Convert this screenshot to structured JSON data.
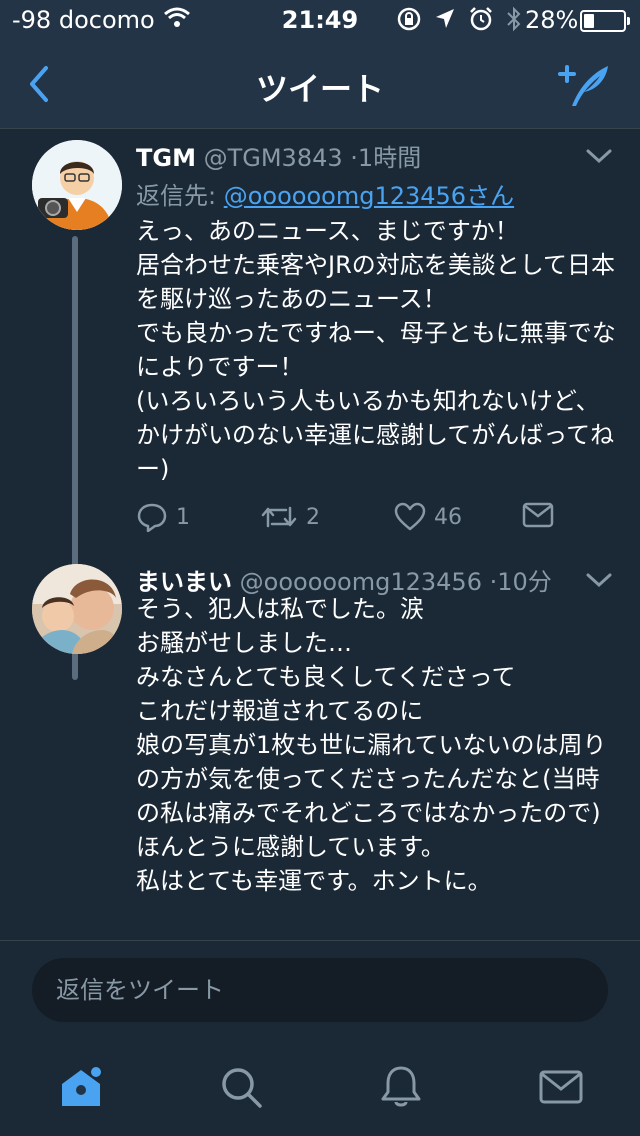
{
  "status": {
    "carrier": "-98 docomo",
    "time": "21:49",
    "battery": "28%"
  },
  "nav": {
    "title": "ツイート"
  },
  "tweets": [
    {
      "name": "TGM",
      "handle": "@TGM3843",
      "time": "1時間",
      "reply_label": "返信先:",
      "reply_to": "@oooooomg123456さん",
      "body": "えっ、あのニュース、まじですか！\n居合わせた乗客やJRの対応を美談として日本を駆け巡ったあのニュース！\nでも良かったですねー、母子ともに無事でなによりですー！\n(いろいろいう人もいるかも知れないけど、かけがいのない幸運に感謝してがんばってねー)",
      "reply_count": "1",
      "retweet_count": "2",
      "like_count": "46"
    },
    {
      "name": "まいまい",
      "handle": "@oooooomg123456",
      "time": "10分",
      "body": "そう、犯人は私でした。涙\nお騒がせしました…\nみなさんとても良くしてくださって\nこれだけ報道されてるのに\n娘の写真が1枚も世に漏れていないのは周りの方が気を使ってくださったんだなと(当時の私は痛みでそれどころではなかったので)ほんとうに感謝しています。\n私はとても幸運です。ホントに。"
    }
  ],
  "reply_box": {
    "placeholder": "返信をツイート"
  },
  "colors": {
    "background": "#1b2836",
    "header": "#243447",
    "accent": "#4aa3f0",
    "muted": "#8899a6"
  },
  "tabbar": {
    "items": [
      "home-icon",
      "search-icon",
      "notifications-icon",
      "messages-icon"
    ]
  }
}
